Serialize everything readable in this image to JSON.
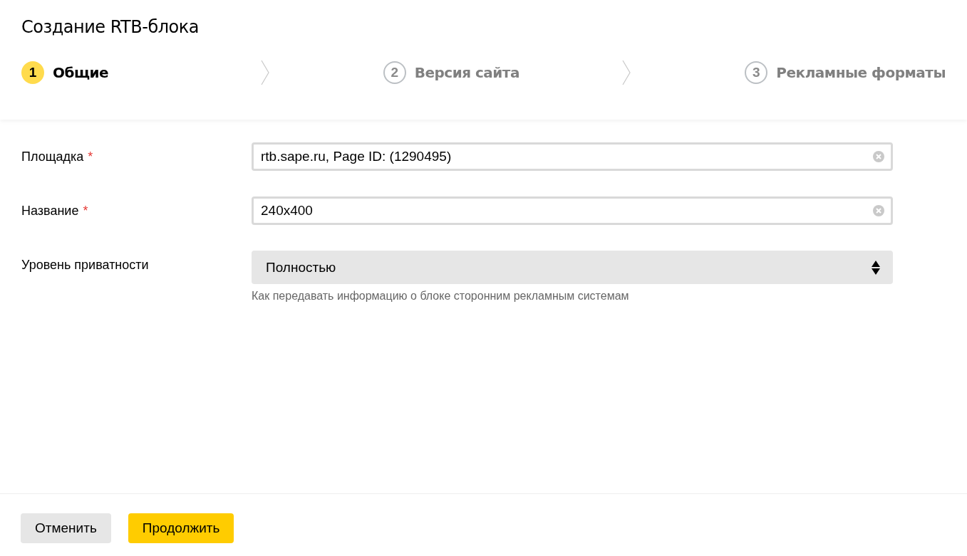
{
  "title": "Создание RTB-блока",
  "steps": [
    {
      "number": "1",
      "label": "Общие",
      "selected": true
    },
    {
      "number": "2",
      "label": "Версия сайта",
      "selected": false
    },
    {
      "number": "3",
      "label": "Рекламные форматы",
      "selected": false
    }
  ],
  "fields": [
    {
      "kind": "text",
      "label": "Площадка",
      "required_mark": "*",
      "value": "rtb.sape.ru, Page ID: (1290495)"
    },
    {
      "kind": "text",
      "label": "Название",
      "required_mark": "*",
      "value": "240x400"
    },
    {
      "kind": "select",
      "label": "Уровень приватности",
      "value": "Полностью",
      "hint": "Как передавать информацию о блоке сторонним рекламным системам"
    }
  ],
  "buttons": [
    {
      "label": "Отменить",
      "kind": "secondary"
    },
    {
      "label": "Продолжить",
      "kind": "primary"
    }
  ]
}
